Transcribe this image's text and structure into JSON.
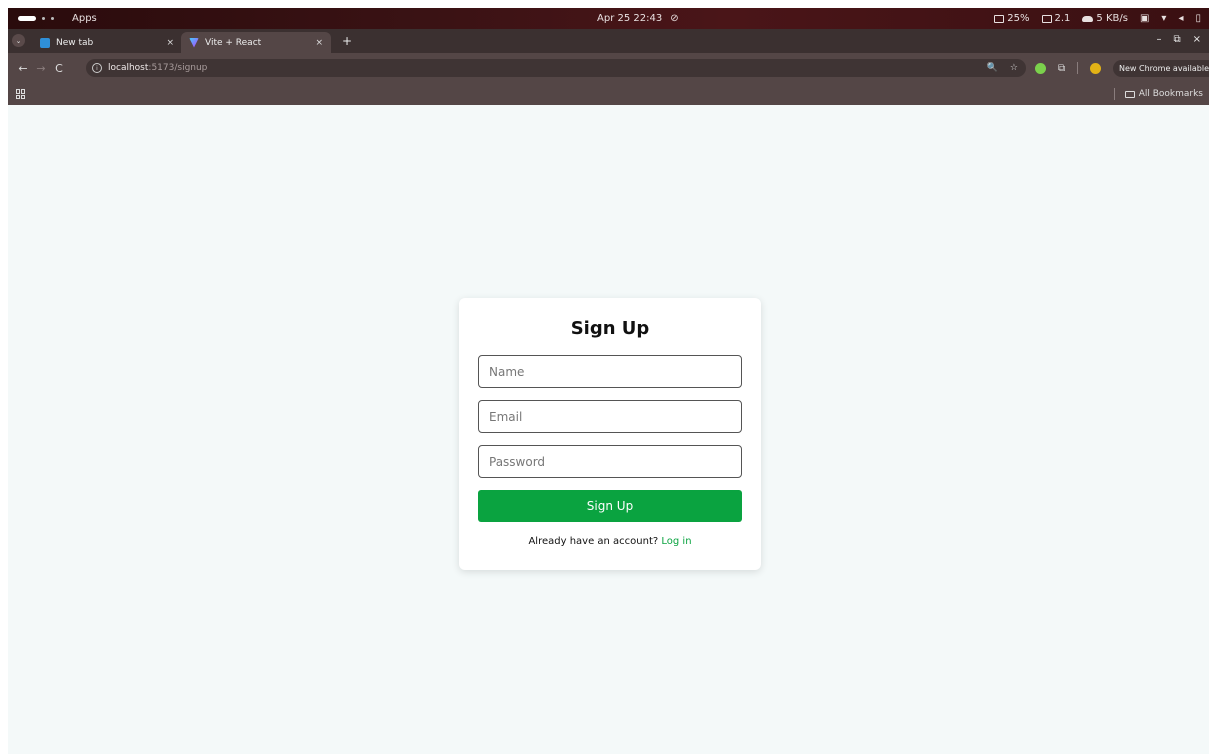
{
  "os_bar": {
    "apps_label": "Apps",
    "datetime": "Apr 25 22:43",
    "dnd_icon": "bell-off-icon",
    "stats": {
      "cpu": "25%",
      "load": "2.1",
      "net": "5 KB/s"
    }
  },
  "browser": {
    "tabs": [
      {
        "title": "New tab",
        "close": "×",
        "favicon": "new-tab-icon"
      },
      {
        "title": "Vite + React",
        "close": "×",
        "favicon": "vite-icon"
      }
    ],
    "new_tab_symbol": "+",
    "window_controls": {
      "minimize": "–",
      "restore": "⧉",
      "close": "×"
    },
    "nav": {
      "back": "←",
      "forward": "→",
      "reload": "C"
    },
    "url_host": "localhost",
    "url_path": ":5173/signup",
    "omnibox_zoom": "🔍",
    "omnibox_star": "☆",
    "update_label": "New Chrome available",
    "update_menu": "⋮",
    "bookmarks_all": "All Bookmarks"
  },
  "signup": {
    "heading": "Sign Up",
    "name_placeholder": "Name",
    "email_placeholder": "Email",
    "password_placeholder": "Password",
    "submit_label": "Sign Up",
    "footer_text": "Already have an account?",
    "login_link": "Log in"
  },
  "colors": {
    "accent": "#0aa340",
    "page_bg": "#f4f9f9",
    "chrome_bar": "#544646"
  }
}
